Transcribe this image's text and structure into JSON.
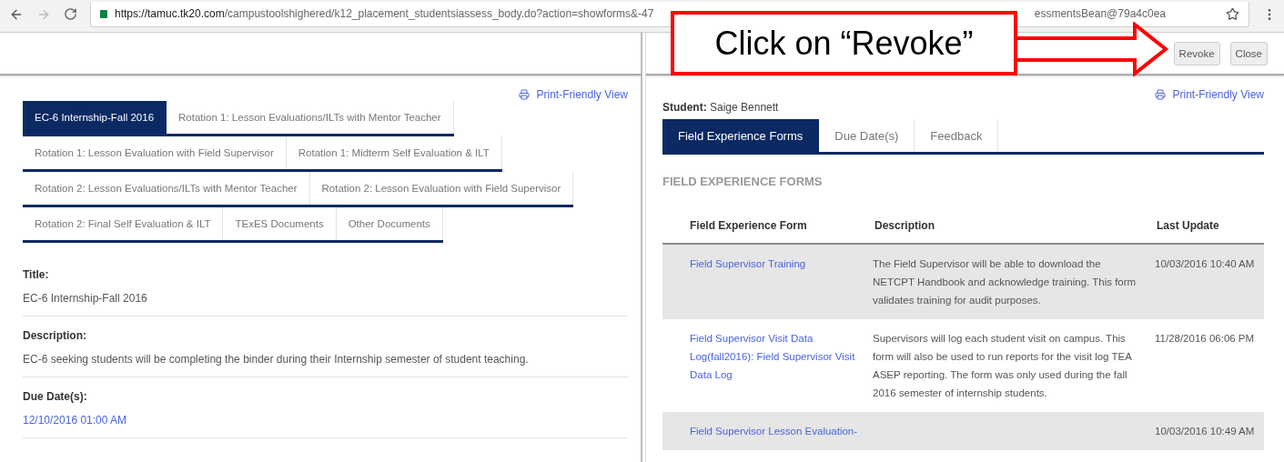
{
  "browser": {
    "url_host": "https://tamuc.tk20.com",
    "url_path": "/campustoolshighered/k12_placement_studentsiassess_body.do?action=showforms&-47",
    "url_end": "essmentsBean@79a4c0ea"
  },
  "callout": {
    "text": "Click on “Revoke”"
  },
  "left_panel": {
    "print_link": "Print-Friendly View",
    "tab_rows": [
      [
        {
          "label": "EC-6 Internship-Fall 2016",
          "selected": true
        },
        {
          "label": "Rotation 1: Lesson Evaluations/ILTs with Mentor Teacher",
          "selected": false
        }
      ],
      [
        {
          "label": "Rotation 1: Lesson Evaluation with Field Supervisor",
          "selected": false
        },
        {
          "label": "Rotation 1: Midterm Self Evaluation & ILT",
          "selected": false
        }
      ],
      [
        {
          "label": "Rotation 2: Lesson Evaluations/ILTs with Mentor Teacher",
          "selected": false
        },
        {
          "label": "Rotation 2: Lesson Evaluation with Field Supervisor",
          "selected": false
        }
      ],
      [
        {
          "label": "Rotation 2: Final Self Evaluation & ILT",
          "selected": false
        },
        {
          "label": "TExES Documents",
          "selected": false
        },
        {
          "label": "Other Documents",
          "selected": false
        }
      ]
    ],
    "fields": [
      {
        "label": "Title:",
        "value": "EC-6 Internship-Fall 2016",
        "kind": "text"
      },
      {
        "label": "Description:",
        "value": "EC-6 seeking students will be completing the binder during their Internship semester of student teaching.",
        "kind": "text"
      },
      {
        "label": "Due Date(s):",
        "value": "12/10/2016 01:00 AM",
        "kind": "link"
      }
    ]
  },
  "right_panel": {
    "buttons": [
      "Revoke",
      "Close"
    ],
    "print_link": "Print-Friendly View",
    "student_label": "Student:",
    "student_name": "Saige Bennett",
    "tabs": [
      {
        "label": "Field Experience Forms",
        "selected": true
      },
      {
        "label": "Due Date(s)",
        "selected": false
      },
      {
        "label": "Feedback",
        "selected": false
      }
    ],
    "section_title": "FIELD EXPERIENCE FORMS",
    "table": {
      "columns": [
        "Field Experience Form",
        "Description",
        "Last Update"
      ],
      "rows": [
        {
          "form": "Field Supervisor Training",
          "description": "The Field Supervisor will be able to download the NETCPT Handbook and acknowledge training. This form validates training for audit purposes.",
          "last_update": "10/03/2016 10:40 AM"
        },
        {
          "form": "Field Supervisor Visit Data Log(fall2016): Field Supervisor Visit Data Log",
          "description": "Supervisors will log each student visit on campus. This form will also be used to run reports for the visit log TEA ASEP reporting. The form was only used during the fall 2016 semester of internship students.",
          "last_update": "11/28/2016 06:06 PM"
        },
        {
          "form": "Field Supervisor Lesson Evaluation-",
          "description": "",
          "last_update": "10/03/2016 10:49 AM"
        }
      ]
    }
  }
}
